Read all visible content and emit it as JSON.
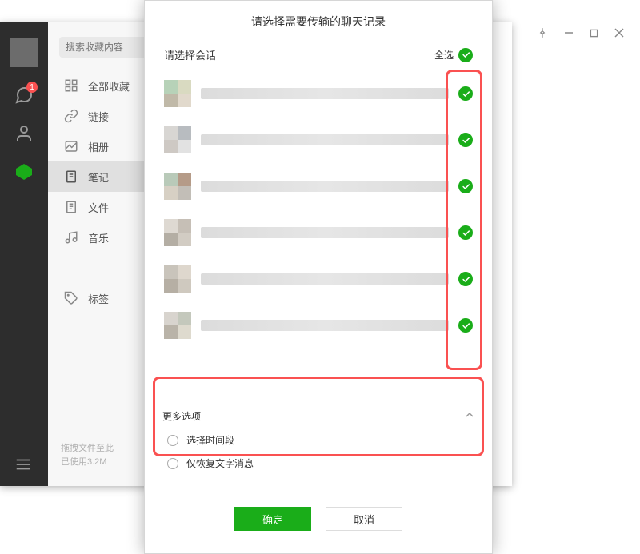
{
  "sidebar": {
    "search_placeholder": "搜索收藏内容",
    "items": [
      {
        "label": "全部收藏"
      },
      {
        "label": "链接"
      },
      {
        "label": "相册"
      },
      {
        "label": "笔记"
      },
      {
        "label": "文件"
      },
      {
        "label": "音乐"
      },
      {
        "label": "标签"
      }
    ],
    "footer_line1": "拖拽文件至此",
    "footer_line2": "已使用3.2M",
    "rail_badge": "1"
  },
  "dialog": {
    "title": "请选择需要传输的聊天记录",
    "select_section_label": "请选择会话",
    "select_all_label": "全选",
    "more_options_label": "更多选项",
    "option_time_range": "选择时间段",
    "option_text_only": "仅恢复文字消息",
    "confirm_label": "确定",
    "cancel_label": "取消",
    "conversation_count": 6
  }
}
